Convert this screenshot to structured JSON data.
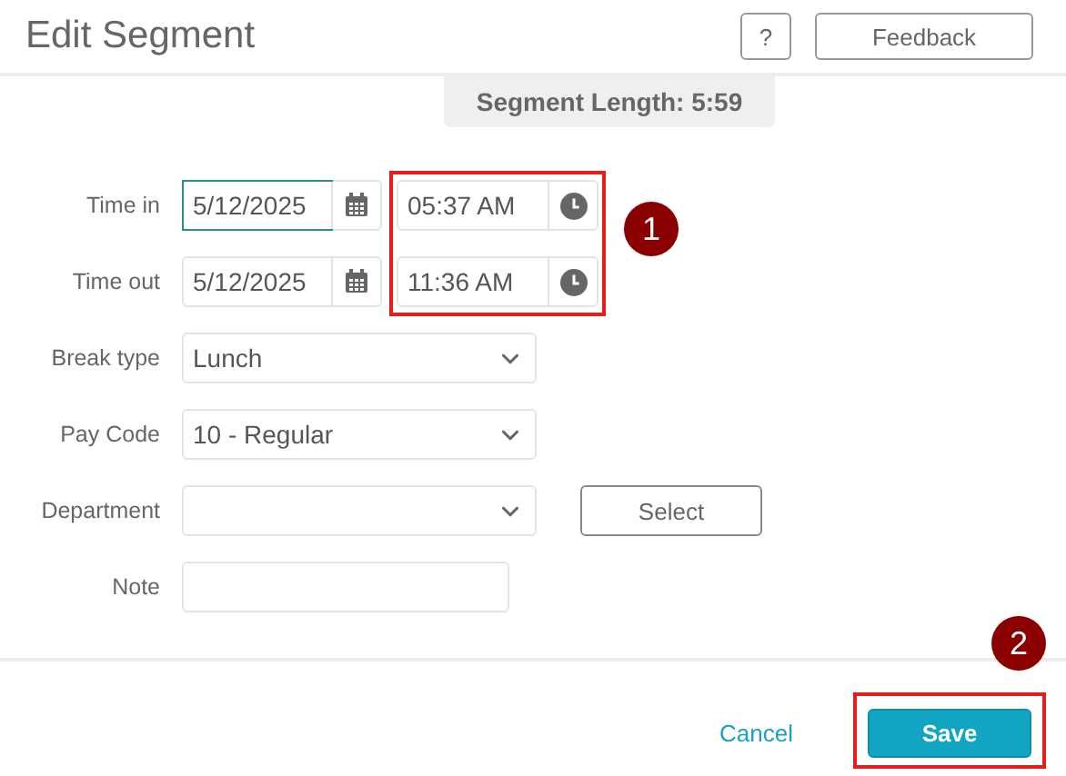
{
  "dialog": {
    "title": "Edit Segment",
    "help_button": "?",
    "feedback_button": "Feedback"
  },
  "segment_length": "Segment Length: 5:59",
  "time_rows": [
    {
      "label": "Time in",
      "date": "5/12/2025",
      "focused": true,
      "time": "05:37 AM"
    },
    {
      "label": "Time out",
      "date": "5/12/2025",
      "focused": false,
      "time": "11:36 AM"
    }
  ],
  "selects": [
    {
      "label": "Break type",
      "value": "Lunch"
    },
    {
      "label": "Pay Code",
      "value": "10 - Regular"
    },
    {
      "label": "Department",
      "button": "Select"
    }
  ],
  "note": {
    "label": "Note"
  },
  "footer": {
    "cancel": "Cancel",
    "save": "Save"
  },
  "callouts": [
    {
      "number": "1"
    },
    {
      "number": "2"
    }
  ]
}
